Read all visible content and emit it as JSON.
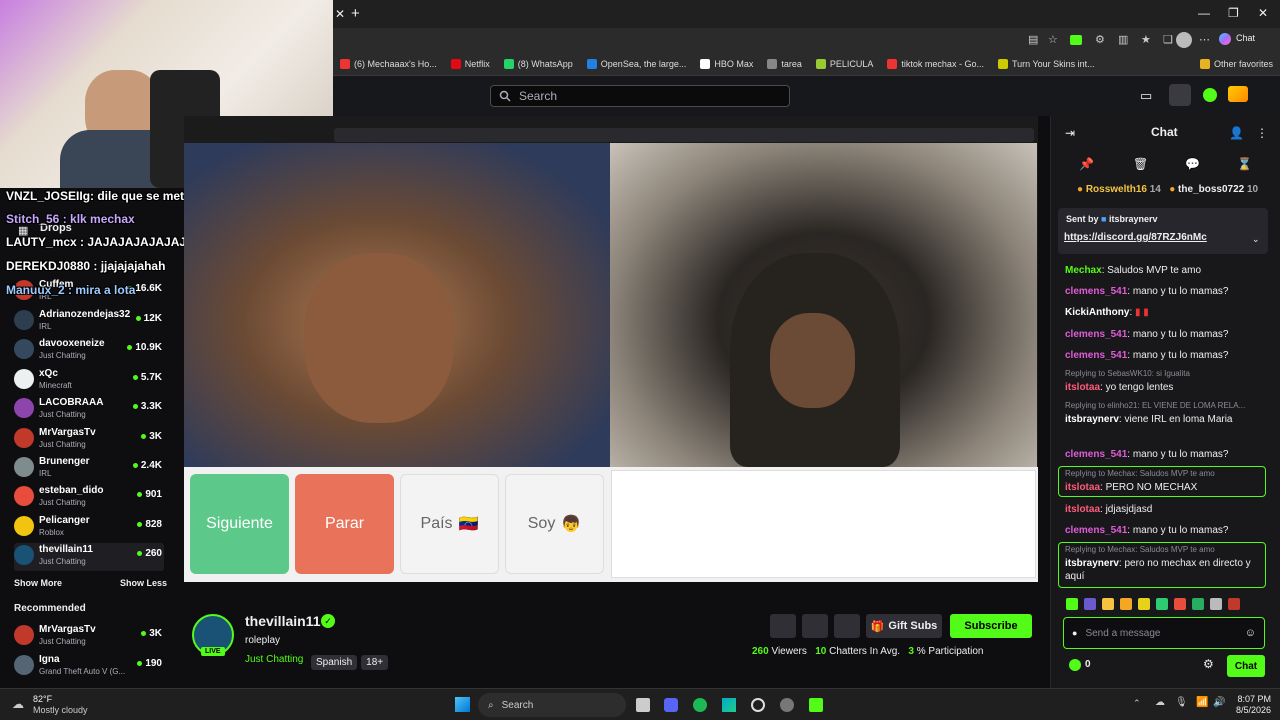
{
  "browser": {
    "new_tab": "+",
    "chat_label": "Chat",
    "bookmarks": [
      {
        "label": "(6) Mechaaax's Ho...",
        "color": "#e33"
      },
      {
        "label": "Netflix",
        "color": "#e50914"
      },
      {
        "label": "(8) WhatsApp",
        "color": "#25d366"
      },
      {
        "label": "OpenSea, the large...",
        "color": "#2081e2"
      },
      {
        "label": "HBO Max",
        "color": "#fff"
      },
      {
        "label": "tarea",
        "color": "#888"
      },
      {
        "label": "PELICULA",
        "color": "#9c3"
      },
      {
        "label": "tiktok mechax - Go...",
        "color": "#e33"
      },
      {
        "label": "Turn Your Skins int...",
        "color": "#cc0"
      }
    ],
    "other_favorites": "Other favorites"
  },
  "kick": {
    "search_placeholder": "Search"
  },
  "overlay_chat": [
    "VNZL_JOSEIIg: dile que se meta a un dc contigo",
    "Stitch_56 : klk mechax",
    "LAUTY_mcx : JAJAJAJAJAJAJA",
    "DEREKDJ0880 : jjajajajahah",
    "Manuux_2 : mira a lota"
  ],
  "sidebar": {
    "drops": "Drops",
    "channels": [
      {
        "name": "Cuffem",
        "category": "IRL",
        "viewers": "16.6K",
        "color": "#c0392b"
      },
      {
        "name": "Adrianozendejas32",
        "category": "IRL",
        "viewers": "12K",
        "color": "#2c3e50"
      },
      {
        "name": "davooxeneize",
        "category": "Just Chatting",
        "viewers": "10.9K",
        "color": "#34495e"
      },
      {
        "name": "xQc",
        "category": "Minecraft",
        "viewers": "5.7K",
        "color": "#ecf0f1"
      },
      {
        "name": "LACOBRAAA",
        "category": "Just Chatting",
        "viewers": "3.3K",
        "color": "#8e44ad"
      },
      {
        "name": "MrVargasTv",
        "category": "Just Chatting",
        "viewers": "3K",
        "color": "#c0392b"
      },
      {
        "name": "Brunenger",
        "category": "IRL",
        "viewers": "2.4K",
        "color": "#7f8c8d"
      },
      {
        "name": "esteban_dido",
        "category": "Just Chatting",
        "viewers": "901",
        "color": "#e74c3c"
      },
      {
        "name": "Pelicanger",
        "category": "Roblox",
        "viewers": "828",
        "color": "#f1c40f"
      },
      {
        "name": "thevillain11",
        "category": "Just Chatting",
        "viewers": "260",
        "color": "#1a5276"
      }
    ],
    "show_more": "Show More",
    "show_less": "Show Less",
    "recommended": "Recommended",
    "recommended_channels": [
      {
        "name": "MrVargasTv",
        "category": "Just Chatting",
        "viewers": "3K",
        "color": "#c0392b"
      },
      {
        "name": "Igna",
        "category": "Grand Theft Auto V (G...",
        "viewers": "190",
        "color": "#566573"
      }
    ]
  },
  "game": {
    "siguiente": "Siguiente",
    "parar": "Parar",
    "pais": "País",
    "soy": "Soy",
    "pais_flag": "🇻🇪",
    "soy_emoji": "👦"
  },
  "stream": {
    "channel": "thevillain11",
    "live": "LIVE",
    "title": "roleplay",
    "category": "Just Chatting",
    "tags": [
      "Spanish",
      "18+"
    ],
    "gift_subs": "Gift Subs",
    "subscribe": "Subscribe",
    "viewers_count": "260",
    "viewers_label": "Viewers",
    "chatters_count": "10",
    "chatters_label": "Chatters In Avg.",
    "participation_count": "3",
    "participation_label": "% Participation"
  },
  "chat": {
    "header": "Chat",
    "leaders": [
      {
        "name": "Rosswelth16",
        "count": "14"
      },
      {
        "name": "the_boss0722",
        "count": "10"
      }
    ],
    "pinned_sent_by": "Sent by",
    "pinned_user": "itsbraynerv",
    "pinned_link": "https://discord.gg/87RZJ6nMc",
    "messages": [
      {
        "user": "Mechax",
        "text": "Saludos MVP te amo"
      },
      {
        "user": "clemens_541",
        "text": "mano y tu lo mamas?"
      },
      {
        "user": "KickiAnthony",
        "text": ""
      },
      {
        "user": "clemens_541",
        "text": "mano y tu lo mamas?"
      },
      {
        "user": "clemens_541",
        "text": "mano y tu lo mamas?"
      },
      {
        "reply": "Replying to SebasWK10: si Igualita",
        "user": "itslotaa",
        "text": "yo tengo lentes"
      },
      {
        "reply": "Replying to elinho21: EL VIENE DE LOMA RELA...",
        "user": "itsbraynerv",
        "text": "viene IRL en loma Maria"
      },
      {
        "user": "clemens_541",
        "text": "mano y tu lo mamas?"
      },
      {
        "reply": "Replying to Mechax: Saludos MVP te amo",
        "user": "itslotaa",
        "text": "PERO NO MECHAX"
      },
      {
        "user": "itslotaa",
        "text": "jdjasjdjasd"
      },
      {
        "user": "clemens_541",
        "text": "mano y tu lo mamas?"
      },
      {
        "reply": "Replying to Mechax: Saludos MVP te amo",
        "user": "itsbraynerv",
        "text": "pero no mechax en directo y aquí"
      }
    ],
    "input_placeholder": "Send a message",
    "points": "0",
    "send": "Chat"
  },
  "taskbar": {
    "temp": "82°F",
    "weather": "Mostly cloudy",
    "search": "Search",
    "time": "8:07 PM",
    "date": "8/5/2026"
  }
}
